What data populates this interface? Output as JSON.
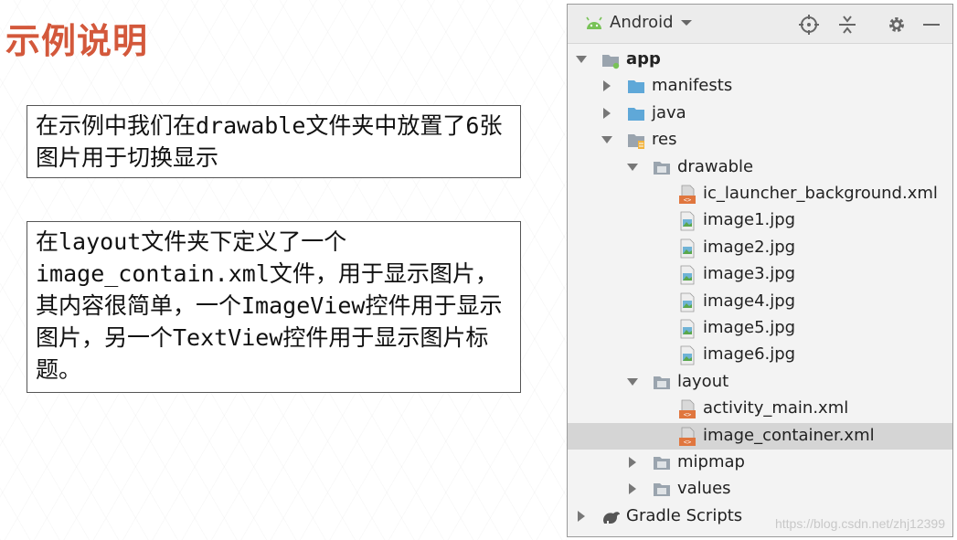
{
  "slide": {
    "title": "示例说明",
    "note1": "在示例中我们在drawable文件夹中放置了6张图片用于切换显示",
    "note2": "在layout文件夹下定义了一个image_contain.xml文件，用于显示图片，其内容很简单，一个ImageView控件用于显示图片，另一个TextView控件用于显示图片标题。"
  },
  "panel": {
    "view_mode": "Android",
    "colors": {
      "android_green": "#78c257",
      "folder_blue": "#5fa8d8",
      "xml_orange": "#e0763e",
      "slide_title": "#d3583b"
    },
    "tree": [
      {
        "label": "app",
        "bold": true,
        "icon": "module-folder-icon",
        "level": 0,
        "arrow": "down"
      },
      {
        "label": "manifests",
        "icon": "folder-icon",
        "level": 1,
        "arrow": "right"
      },
      {
        "label": "java",
        "icon": "folder-icon",
        "level": 1,
        "arrow": "right"
      },
      {
        "label": "res",
        "icon": "res-folder-icon",
        "level": 1,
        "arrow": "down"
      },
      {
        "label": "drawable",
        "icon": "res-subfolder-icon",
        "level": 2,
        "arrow": "down"
      },
      {
        "label": "ic_launcher_background.xml",
        "icon": "xml-file-icon",
        "level": 3,
        "arrow": ""
      },
      {
        "label": "image1.jpg",
        "icon": "image-file-icon",
        "level": 3,
        "arrow": ""
      },
      {
        "label": "image2.jpg",
        "icon": "image-file-icon",
        "level": 3,
        "arrow": ""
      },
      {
        "label": "image3.jpg",
        "icon": "image-file-icon",
        "level": 3,
        "arrow": ""
      },
      {
        "label": "image4.jpg",
        "icon": "image-file-icon",
        "level": 3,
        "arrow": ""
      },
      {
        "label": "image5.jpg",
        "icon": "image-file-icon",
        "level": 3,
        "arrow": ""
      },
      {
        "label": "image6.jpg",
        "icon": "image-file-icon",
        "level": 3,
        "arrow": ""
      },
      {
        "label": "layout",
        "icon": "res-subfolder-icon",
        "level": 2,
        "arrow": "down"
      },
      {
        "label": "activity_main.xml",
        "icon": "xml-file-icon",
        "level": 3,
        "arrow": ""
      },
      {
        "label": "image_container.xml",
        "icon": "xml-file-icon",
        "level": 3,
        "arrow": "",
        "selected": true
      },
      {
        "label": "mipmap",
        "icon": "res-subfolder-icon",
        "level": 2,
        "arrow": "right"
      },
      {
        "label": "values",
        "icon": "res-subfolder-icon",
        "level": 2,
        "arrow": "right"
      },
      {
        "label": "Gradle Scripts",
        "icon": "gradle-icon",
        "level": 0,
        "arrow": "right"
      }
    ]
  },
  "watermark": "https://blog.csdn.net/zhj12399"
}
